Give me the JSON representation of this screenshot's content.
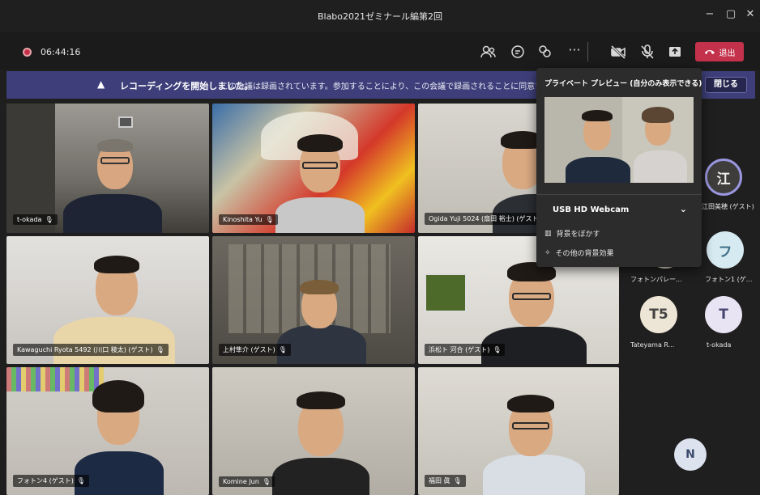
{
  "window": {
    "title": "Blabo2021ゼミナール編第2回"
  },
  "toolbar": {
    "timer": "06:44:16",
    "leave_label": "退出"
  },
  "banner": {
    "bold_text": "レコーディングを開始しました。",
    "message": "この会議は録画されています。参加することにより、この会議で録画されることに同意するものとします。",
    "close_label": "閉じる"
  },
  "tiles": [
    {
      "name": "t-okada"
    },
    {
      "name": "Kinoshita Yu"
    },
    {
      "name": "Ogida Yuji 5024 (扇田 裕士) (ゲスト)"
    },
    {
      "name": "Kawaguchi Ryota 5492 (川口 稜太) (ゲスト)"
    },
    {
      "name": "上村隼介 (ゲスト)"
    },
    {
      "name": "浜松ト 河合 (ゲスト)"
    },
    {
      "name": "フォトン4 (ゲスト)"
    },
    {
      "name": "Komine Jun"
    },
    {
      "name": "福田 眞"
    }
  ],
  "roster": [
    {
      "initials": "江",
      "label": "江田美穂 (ゲスト)"
    },
    {
      "initials": "フ",
      "label": "フォトンパレー..."
    },
    {
      "initials": "フ",
      "label": "フォトン1 (ゲ..."
    },
    {
      "initials": "T5",
      "label": "Tateyama R..."
    },
    {
      "initials": "T",
      "label": "t-okada"
    },
    {
      "initials": "N",
      "label": ""
    }
  ],
  "preview": {
    "title": "プライベート プレビュー (自分のみ表示できる)",
    "camera": "USB HD Webcam",
    "blur_label": "背景をぼかす",
    "effects_label": "その他の背景効果"
  },
  "colors": {
    "accent": "#3e3f7a",
    "leave": "#c4314b",
    "avatar_ring": "#9a97e0"
  }
}
